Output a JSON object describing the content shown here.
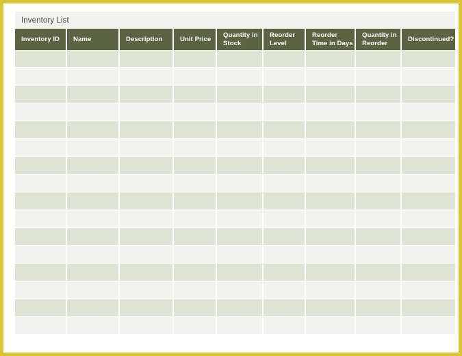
{
  "document": {
    "title": "Inventory List",
    "colors": {
      "page_border": "#dcc437",
      "header_background": "#5c6343",
      "header_text": "#ffffff",
      "row_band_dark": "#dfe5d4",
      "row_band_light": "#f2f3ee",
      "title_band_background": "#f2f3ee",
      "page_background": "#ffffff"
    }
  },
  "table": {
    "columns": [
      {
        "label": "Inventory ID",
        "width": 76
      },
      {
        "label": "Name",
        "width": 77
      },
      {
        "label": "Description",
        "width": 79
      },
      {
        "label": "Unit Price",
        "width": 63
      },
      {
        "label": "Quantity in Stock",
        "width": 68
      },
      {
        "label": "Reorder Level",
        "width": 62
      },
      {
        "label": "Reorder Time in Days",
        "width": 73
      },
      {
        "label": "Quantity in Reorder",
        "width": 67
      },
      {
        "label": "Discontinued?",
        "width": 78
      }
    ],
    "row_count": 16,
    "rows": [
      [
        "",
        "",
        "",
        "",
        "",
        "",
        "",
        "",
        ""
      ],
      [
        "",
        "",
        "",
        "",
        "",
        "",
        "",
        "",
        ""
      ],
      [
        "",
        "",
        "",
        "",
        "",
        "",
        "",
        "",
        ""
      ],
      [
        "",
        "",
        "",
        "",
        "",
        "",
        "",
        "",
        ""
      ],
      [
        "",
        "",
        "",
        "",
        "",
        "",
        "",
        "",
        ""
      ],
      [
        "",
        "",
        "",
        "",
        "",
        "",
        "",
        "",
        ""
      ],
      [
        "",
        "",
        "",
        "",
        "",
        "",
        "",
        "",
        ""
      ],
      [
        "",
        "",
        "",
        "",
        "",
        "",
        "",
        "",
        ""
      ],
      [
        "",
        "",
        "",
        "",
        "",
        "",
        "",
        "",
        ""
      ],
      [
        "",
        "",
        "",
        "",
        "",
        "",
        "",
        "",
        ""
      ],
      [
        "",
        "",
        "",
        "",
        "",
        "",
        "",
        "",
        ""
      ],
      [
        "",
        "",
        "",
        "",
        "",
        "",
        "",
        "",
        ""
      ],
      [
        "",
        "",
        "",
        "",
        "",
        "",
        "",
        "",
        ""
      ],
      [
        "",
        "",
        "",
        "",
        "",
        "",
        "",
        "",
        ""
      ],
      [
        "",
        "",
        "",
        "",
        "",
        "",
        "",
        "",
        ""
      ],
      [
        "",
        "",
        "",
        "",
        "",
        "",
        "",
        "",
        ""
      ]
    ]
  }
}
